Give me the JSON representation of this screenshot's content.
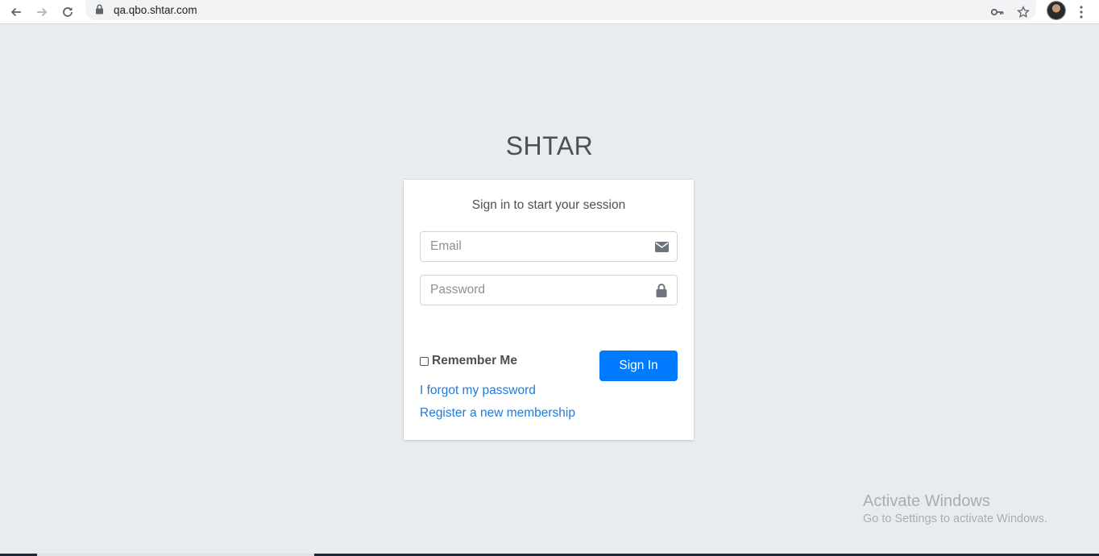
{
  "browser": {
    "url": "qa.qbo.shtar.com",
    "icons": [
      "back-icon",
      "forward-icon",
      "reload-icon",
      "lock-icon",
      "key-icon",
      "star-icon",
      "avatar",
      "menu-icon"
    ]
  },
  "login": {
    "brand": "SHTAR",
    "message": "Sign in to start your session",
    "email_placeholder": "Email",
    "password_placeholder": "Password",
    "remember_label": "Remember Me",
    "sign_in_label": "Sign In",
    "forgot_link": "I forgot my password",
    "register_link": "Register a new membership"
  },
  "watermark": {
    "title": "Activate Windows",
    "subtitle": "Go to Settings to activate Windows."
  },
  "colors": {
    "background": "#e9ecef",
    "primary": "#007bff",
    "link": "#1e7be0",
    "text": "#495057"
  }
}
